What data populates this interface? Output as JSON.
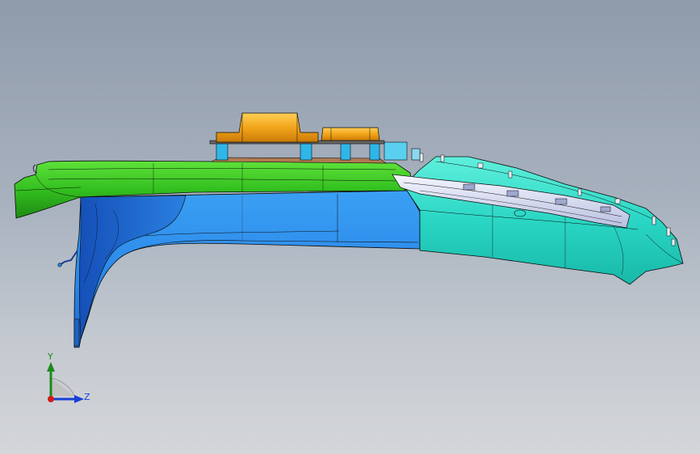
{
  "viewport": {
    "background_top": "#8f9bab",
    "background_bottom": "#d4d6d9"
  },
  "model": {
    "parts": [
      {
        "name": "top-rail-part",
        "color": "#2fbf1f"
      },
      {
        "name": "side-panel-part",
        "color": "#2a86e8"
      },
      {
        "name": "front-cap-part",
        "color": "#26dcc6"
      },
      {
        "name": "mount-block-part",
        "color": "#f2a51a"
      },
      {
        "name": "bracket-rod-part",
        "color": "#2a86e8"
      }
    ],
    "edge_color": "#0a0a0a"
  },
  "triad": {
    "y_label": "Y",
    "z_label": "Z",
    "y_color": "#1c8a1c",
    "z_color": "#1a3fd6",
    "origin_color": "#d21a1a"
  }
}
